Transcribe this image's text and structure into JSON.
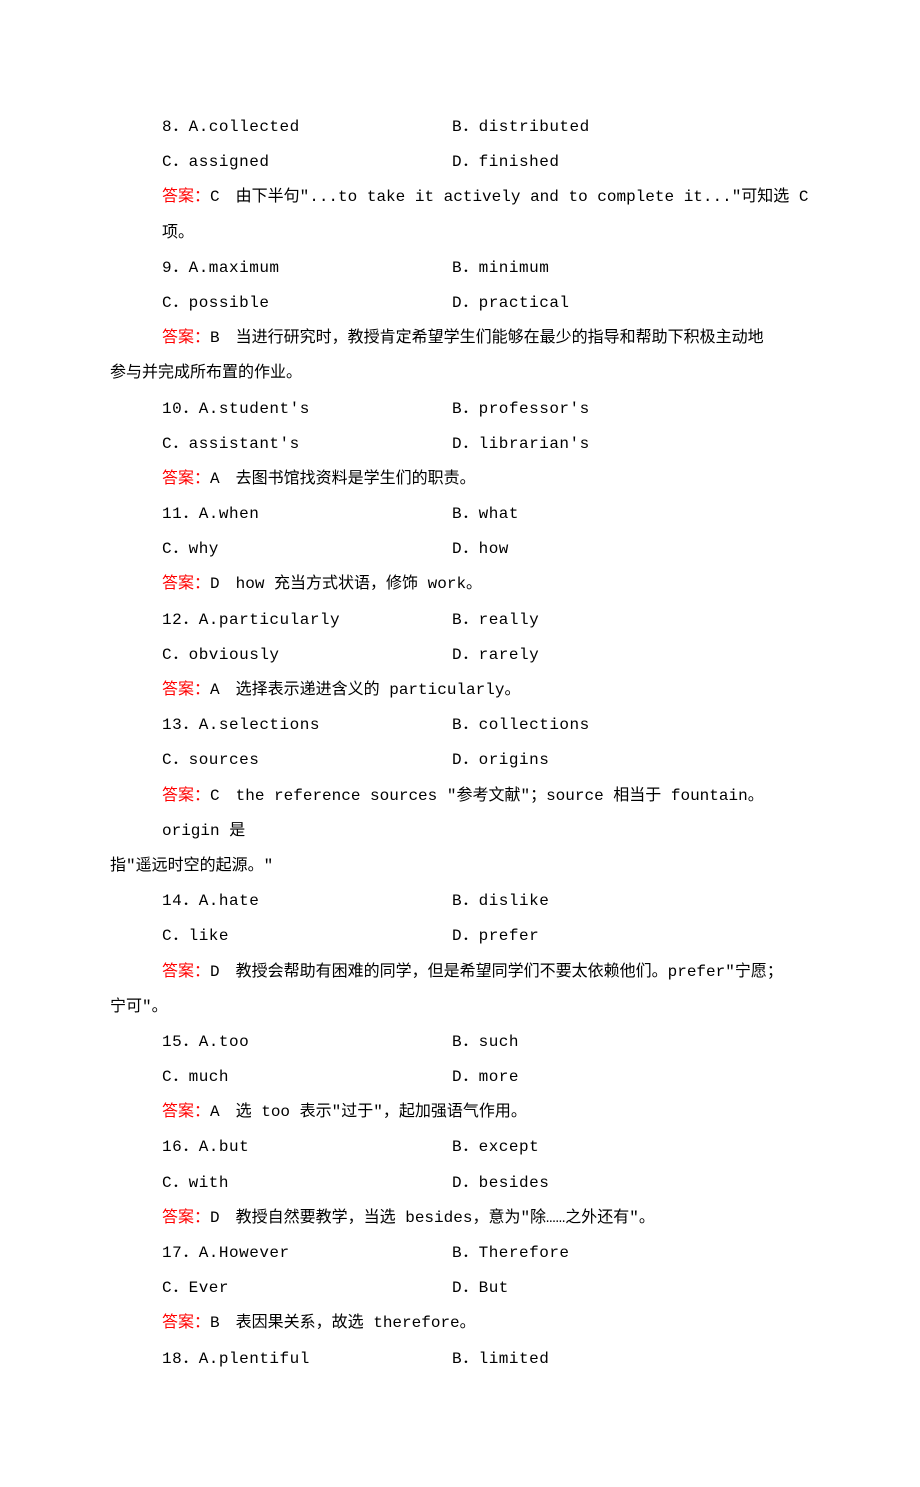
{
  "questions": [
    {
      "num": "8．",
      "optA": "A.collected",
      "optB": "B．distributed",
      "optC": "C．assigned",
      "optD": "D．finished",
      "answer_label": "答案：",
      "answer_key": "C",
      "answer_text": "　由下半句\"...to take it actively and to complete it...\"可知选 C 项。",
      "hanging": false
    },
    {
      "num": "9．",
      "optA": "A.maximum",
      "optB": "B．minimum",
      "optC": "C．possible",
      "optD": "D．practical",
      "answer_label": "答案：",
      "answer_key": "B",
      "answer_text": "　当进行研究时，教授肯定希望学生们能够在最少的指导和帮助下积极主动地",
      "hanging": true,
      "hanging_text": "参与并完成所布置的作业。"
    },
    {
      "num": "10．",
      "optA": "A.student's",
      "optB": "B．professor's",
      "optC": "C．assistant's",
      "optD": "D．librarian's",
      "answer_label": "答案：",
      "answer_key": "A",
      "answer_text": "　去图书馆找资料是学生们的职责。",
      "hanging": false
    },
    {
      "num": "11．",
      "optA": "A.when",
      "optB": "B．what",
      "optC": "C．why",
      "optD": "D．how",
      "answer_label": "答案：",
      "answer_key": "D",
      "answer_text": "　how 充当方式状语，修饰 work。",
      "hanging": false
    },
    {
      "num": "12．",
      "optA": "A.particularly",
      "optB": "B．really",
      "optC": "C．obviously",
      "optD": "D．rarely",
      "answer_label": "答案：",
      "answer_key": "A",
      "answer_text": "　选择表示递进含义的 particularly。",
      "hanging": false
    },
    {
      "num": "13．",
      "optA": "A.selections",
      "optB": "B．collections",
      "optC": "C．sources",
      "optD": "D．origins",
      "answer_label": "答案：",
      "answer_key": "C",
      "answer_text": "　the reference sources \"参考文献\"；source 相当于 fountain。origin 是",
      "hanging": true,
      "hanging_text": "指\"遥远时空的起源。\""
    },
    {
      "num": "14．",
      "optA": "A.hate",
      "optB": "B．dislike",
      "optC": "C．like",
      "optD": "D．prefer",
      "answer_label": "答案：",
      "answer_key": "D",
      "answer_text": "　教授会帮助有困难的同学，但是希望同学们不要太依赖他们。prefer\"宁愿；",
      "hanging": true,
      "hanging_text": "宁可\"。"
    },
    {
      "num": "15．",
      "optA": "A.too",
      "optB": "B．such",
      "optC": "C．much",
      "optD": "D．more",
      "answer_label": "答案：",
      "answer_key": "A",
      "answer_text": "　选 too 表示\"过于\"，起加强语气作用。",
      "hanging": false
    },
    {
      "num": "16．",
      "optA": "A.but",
      "optB": "B．except",
      "optC": "C．with",
      "optD": "D．besides",
      "answer_label": "答案：",
      "answer_key": "D",
      "answer_text": "　教授自然要教学，当选 besides，意为\"除……之外还有\"。",
      "hanging": false
    },
    {
      "num": "17．",
      "optA": "A.However",
      "optB": "B．Therefore",
      "optC": "C．Ever",
      "optD": "D．But",
      "answer_label": "答案：",
      "answer_key": "B",
      "answer_text": "　表因果关系，故选 therefore。",
      "hanging": false
    },
    {
      "num": "18．",
      "optA": "A.plentiful",
      "optB": "B．limited",
      "optC": "",
      "optD": "",
      "answer_label": "",
      "answer_key": "",
      "answer_text": "",
      "hanging": false,
      "partial": true
    }
  ]
}
